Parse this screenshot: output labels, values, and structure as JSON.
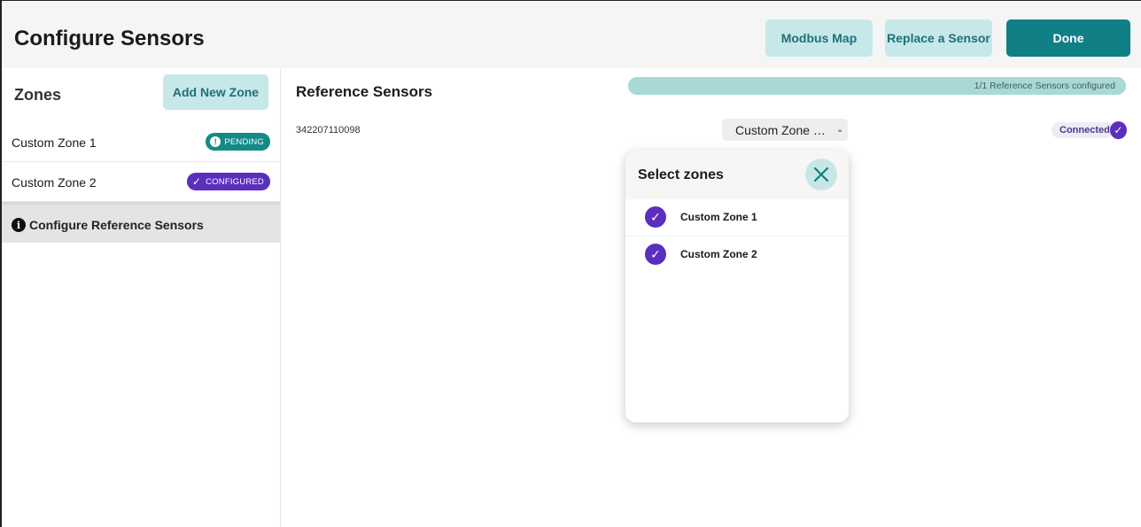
{
  "header": {
    "title": "Configure Sensors",
    "buttons": {
      "modbus": "Modbus Map",
      "replace": "Replace a Sensor",
      "done": "Done"
    }
  },
  "sidebar": {
    "title": "Zones",
    "add_zone_label": "Add New Zone",
    "zones": [
      {
        "label": "Custom Zone 1",
        "badge": "PENDING",
        "badge_icon": "exclamation-icon",
        "badge_color": "#138a86"
      },
      {
        "label": "Custom Zone 2",
        "badge": "CONFIGURED",
        "badge_icon": "check-icon",
        "badge_color": "#5a2fbd"
      }
    ],
    "reference_item": {
      "label": "Configure Reference Sensors",
      "icon": "info-icon"
    }
  },
  "main": {
    "title": "Reference Sensors",
    "progress": {
      "text": "1/1 Reference Sensors configured",
      "fraction": 1.0
    },
    "sensor": {
      "id": "342207110098",
      "zone_select_value": "Custom Zone …",
      "status": "Connected"
    }
  },
  "popup": {
    "title": "Select zones",
    "items": [
      {
        "label": "Custom Zone 1",
        "checked": true
      },
      {
        "label": "Custom Zone 2",
        "checked": true
      }
    ]
  },
  "colors": {
    "accent": "#117f86",
    "accent_light": "#c7e8e8",
    "purple": "#5a2fbd"
  }
}
